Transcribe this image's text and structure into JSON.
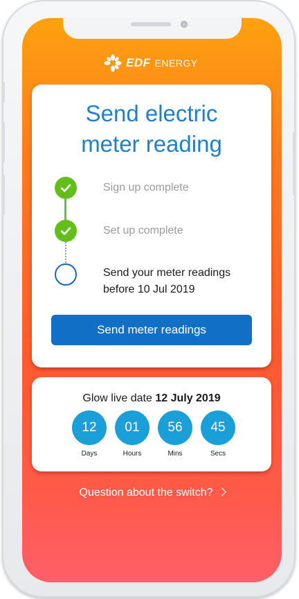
{
  "brand": {
    "edf": "EDF",
    "energy": "ENERGY"
  },
  "main_card": {
    "title": "Send electric meter reading",
    "steps": [
      {
        "label": "Sign up complete",
        "status": "complete"
      },
      {
        "label": "Set up complete",
        "status": "complete"
      },
      {
        "label": "Send your meter readings before 10 Jul 2019",
        "status": "pending"
      }
    ],
    "button_label": "Send meter readings"
  },
  "glow": {
    "title_prefix": "Glow live date",
    "date": "12 July 2019",
    "countdown": [
      {
        "value": "12",
        "label": "Days"
      },
      {
        "value": "01",
        "label": "Hours"
      },
      {
        "value": "56",
        "label": "Mins"
      },
      {
        "value": "45",
        "label": "Secs"
      }
    ]
  },
  "question_link": "Question about the switch?",
  "colors": {
    "accent_blue": "#1170c6",
    "title_blue": "#1f7fc8",
    "check_green": "#64be1a",
    "countdown_blue": "#1b9fd9",
    "gradient_top": "#fca20f",
    "gradient_bottom": "#ff5f6a"
  }
}
